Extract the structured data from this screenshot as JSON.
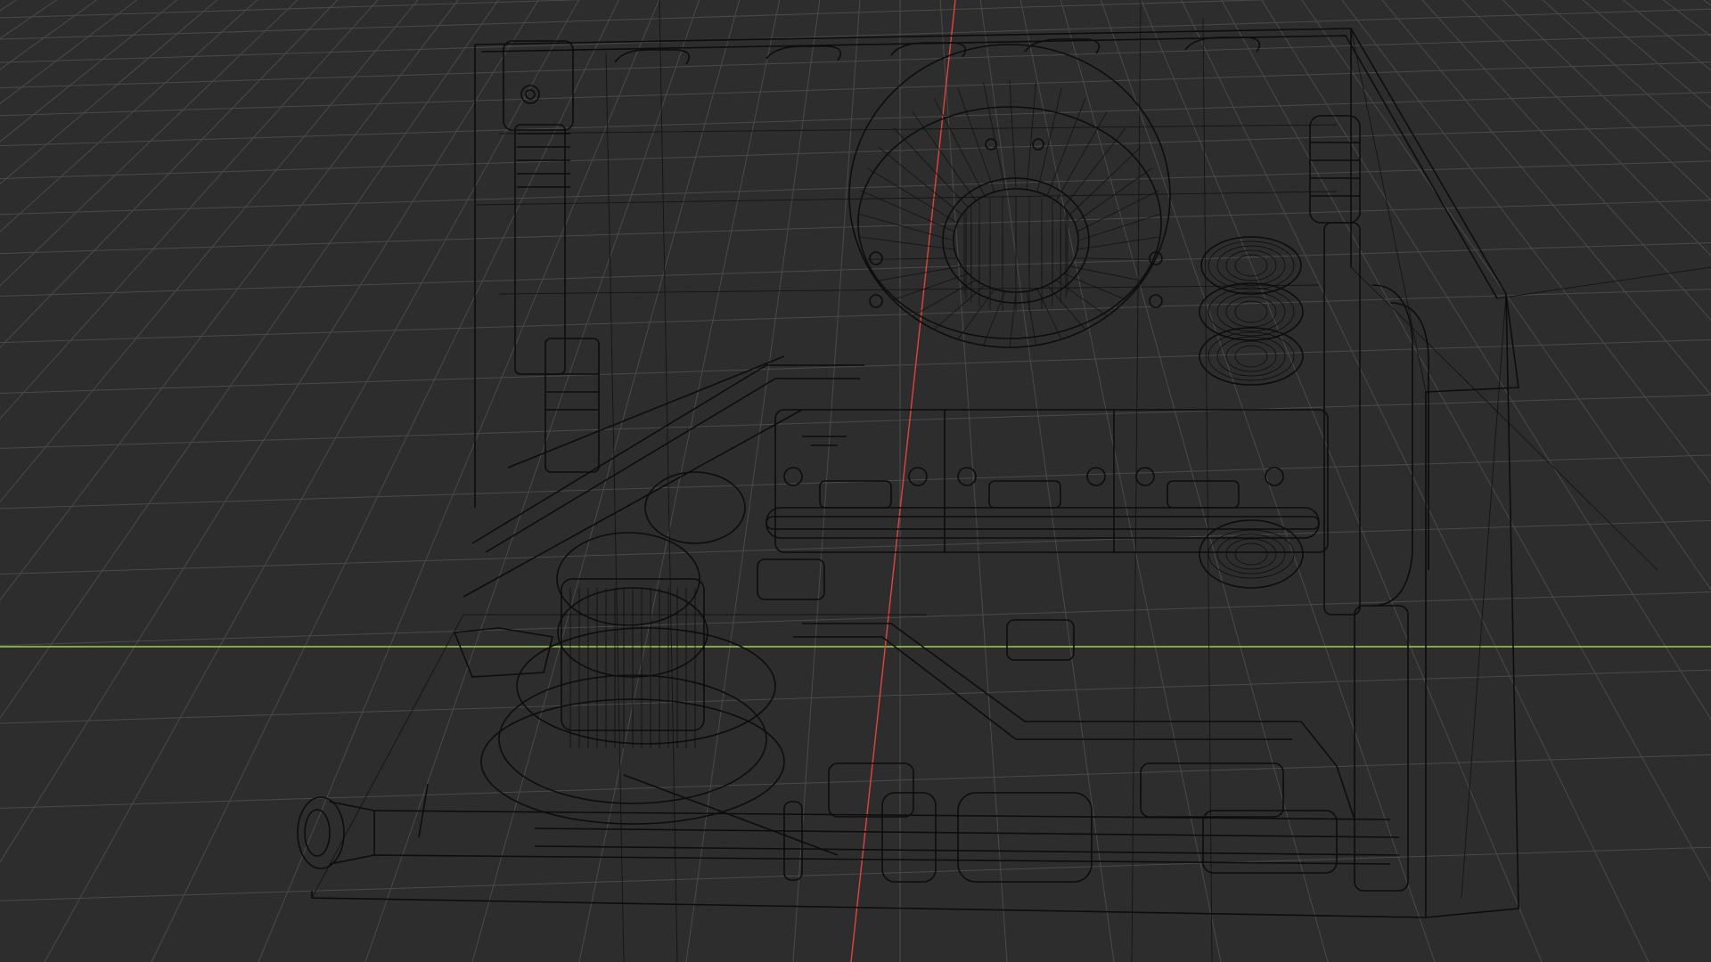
{
  "viewport": {
    "view": "3D Viewport",
    "shading": "wireframe",
    "colors": {
      "background": "#2d2d2d",
      "grid": "#4a4a4a",
      "x_axis": "#9fd24a",
      "y_axis": "#e0443e",
      "wire": "#0d0d0d"
    }
  },
  "scene": {
    "objects": [
      {
        "name": "enclosure-frame"
      },
      {
        "name": "base-plate"
      },
      {
        "name": "left-vertical-tube"
      },
      {
        "name": "top-rear-fan"
      },
      {
        "name": "right-vertical-tube"
      },
      {
        "name": "reservoir-pump"
      },
      {
        "name": "front-horizontal-tube"
      },
      {
        "name": "gpu-block-rail"
      },
      {
        "name": "cable-spools"
      }
    ]
  }
}
